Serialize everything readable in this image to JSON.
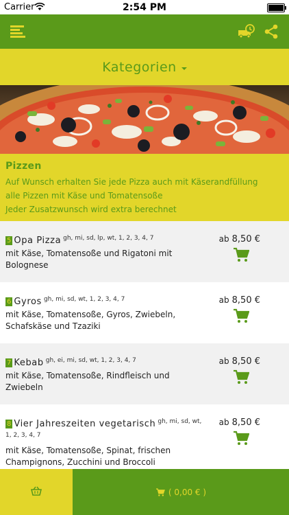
{
  "status_bar": {
    "carrier": "Carrier",
    "time": "2:54 PM"
  },
  "header": {
    "menu_icon": "hamburger-menu-icon",
    "delivery_icon": "delivery-truck-clock-icon",
    "share_icon": "share-icon"
  },
  "category": {
    "title": "Kategorien"
  },
  "info": {
    "heading": "Pizzen",
    "lines": [
      "Auf Wunsch erhalten Sie jede Pizza auch mit Käserandfüllung",
      "alle Pizzen mit Käse und Tomatensoße",
      "Jeder Zusatzwunsch wird extra berechnet"
    ]
  },
  "items": [
    {
      "number": "5",
      "name": "Opa Pizza",
      "allergens": "gh, mi, sd, lp, wt, 1, 2, 3, 4, 7",
      "description": "mit Käse, Tomatensoße und Rigatoni mit Bolognese",
      "price_prefix": "ab",
      "price": "8,50 €"
    },
    {
      "number": "6",
      "name": "Gyros",
      "allergens": "gh, mi, sd, wt, 1, 2, 3, 4, 7",
      "description": "mit Käse, Tomatensoße, Gyros, Zwiebeln, Schafskäse und Tzaziki",
      "price_prefix": "ab",
      "price": "8,50 €"
    },
    {
      "number": "7",
      "name": "Kebab",
      "allergens": "gh, ei, mi, sd, wt, 1, 2, 3, 4, 7",
      "description": "mit Käse, Tomatensoße, Rindfleisch und Zwiebeln",
      "price_prefix": "ab",
      "price": "8,50 €"
    },
    {
      "number": "8",
      "name": "Vier Jahreszeiten vegetarisch",
      "allergens": "gh, mi, sd, wt, 1, 2, 3, 4, 7",
      "description": "mit Käse, Tomatensoße, Spinat, frischen Champignons, Zucchini und Broccoli",
      "price_prefix": "ab",
      "price": "8,50 €"
    }
  ],
  "bottom": {
    "cart_total": "( 0,00 € )"
  },
  "colors": {
    "green": "#5a9a1a",
    "yellow": "#e2d62a",
    "alt_row": "#f1f1f1"
  }
}
